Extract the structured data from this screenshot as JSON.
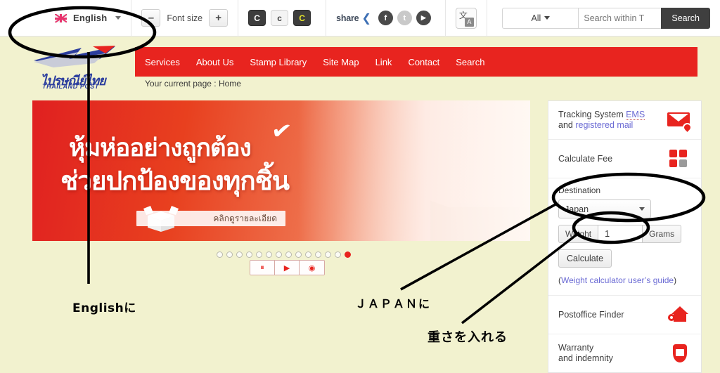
{
  "topbar": {
    "language": "English",
    "flag_icon": "uk-flag-icon",
    "font_size_label": "Font size",
    "font_decrease": "–",
    "font_increase": "+",
    "contrast_buttons": [
      {
        "label": "C",
        "name": "contrast-dark"
      },
      {
        "label": "c",
        "name": "contrast-light"
      },
      {
        "label": "C",
        "name": "contrast-yellow"
      }
    ],
    "share_label": "share",
    "social": [
      {
        "glyph": "f",
        "name": "facebook-icon"
      },
      {
        "glyph": "t",
        "name": "twitter-icon"
      },
      {
        "glyph": "▶",
        "name": "youtube-icon"
      }
    ],
    "translate_icon_glyph": "文",
    "translate_icon_alt": "A",
    "search": {
      "scope": "All",
      "placeholder": "Search within T",
      "button": "Search",
      "value": ""
    }
  },
  "logo": {
    "thai": "ไปรษณีย์ไทย",
    "english": "THAILAND POST"
  },
  "nav": {
    "items": [
      "Services",
      "About Us",
      "Stamp Library",
      "Site Map",
      "Link",
      "Contact",
      "Search"
    ]
  },
  "breadcrumb": "Your current page : Home",
  "banner": {
    "line1": "หุ้มห่ออย่างถูกต้อง",
    "line2": "ช่วยปกป้องของทุกชิ้น",
    "cta": "คลิกดูรายละเอียด",
    "check_glyph": "✔",
    "dot_count": 14,
    "active_dot_index": 13,
    "controls": [
      {
        "glyph": "⏸",
        "name": "carousel-pause-button"
      },
      {
        "glyph": "▶",
        "name": "carousel-play-button"
      },
      {
        "glyph": "◉",
        "name": "carousel-stop-button"
      }
    ]
  },
  "sidebar": {
    "tracking": {
      "line1_prefix": "Tracking System ",
      "line1_link": "EMS",
      "line2_prefix": "and ",
      "line2_link": "registered mail",
      "icon": "envelope-pin-icon"
    },
    "calculate_fee": {
      "title": "Calculate Fee",
      "icon": "calculator-icon"
    },
    "fee_form": {
      "destination_label": "Destination",
      "destination_value": "Japan",
      "weight_label": "Weight",
      "weight_value": "1",
      "weight_unit": "Grams",
      "calculate_button": "Calculate",
      "guide_open": "(",
      "guide_link": "Weight calculator user’s guide",
      "guide_close": ")"
    },
    "postoffice_finder": {
      "title": "Postoffice Finder",
      "icon": "home-search-icon"
    },
    "warranty": {
      "line1": "Warranty",
      "line2": "and indemnity",
      "icon": "shield-icon"
    }
  },
  "annotations": {
    "english_note": "Englishに",
    "japan_note": "ＪＡＰＡＮに",
    "weight_note": "重さを入れる"
  },
  "colors": {
    "page_bg": "#f2f2cf",
    "nav_red": "#e8241f",
    "accent_red": "#e8241f",
    "link_purple": "#6a6ad4",
    "search_dark": "#3f3f3f"
  }
}
